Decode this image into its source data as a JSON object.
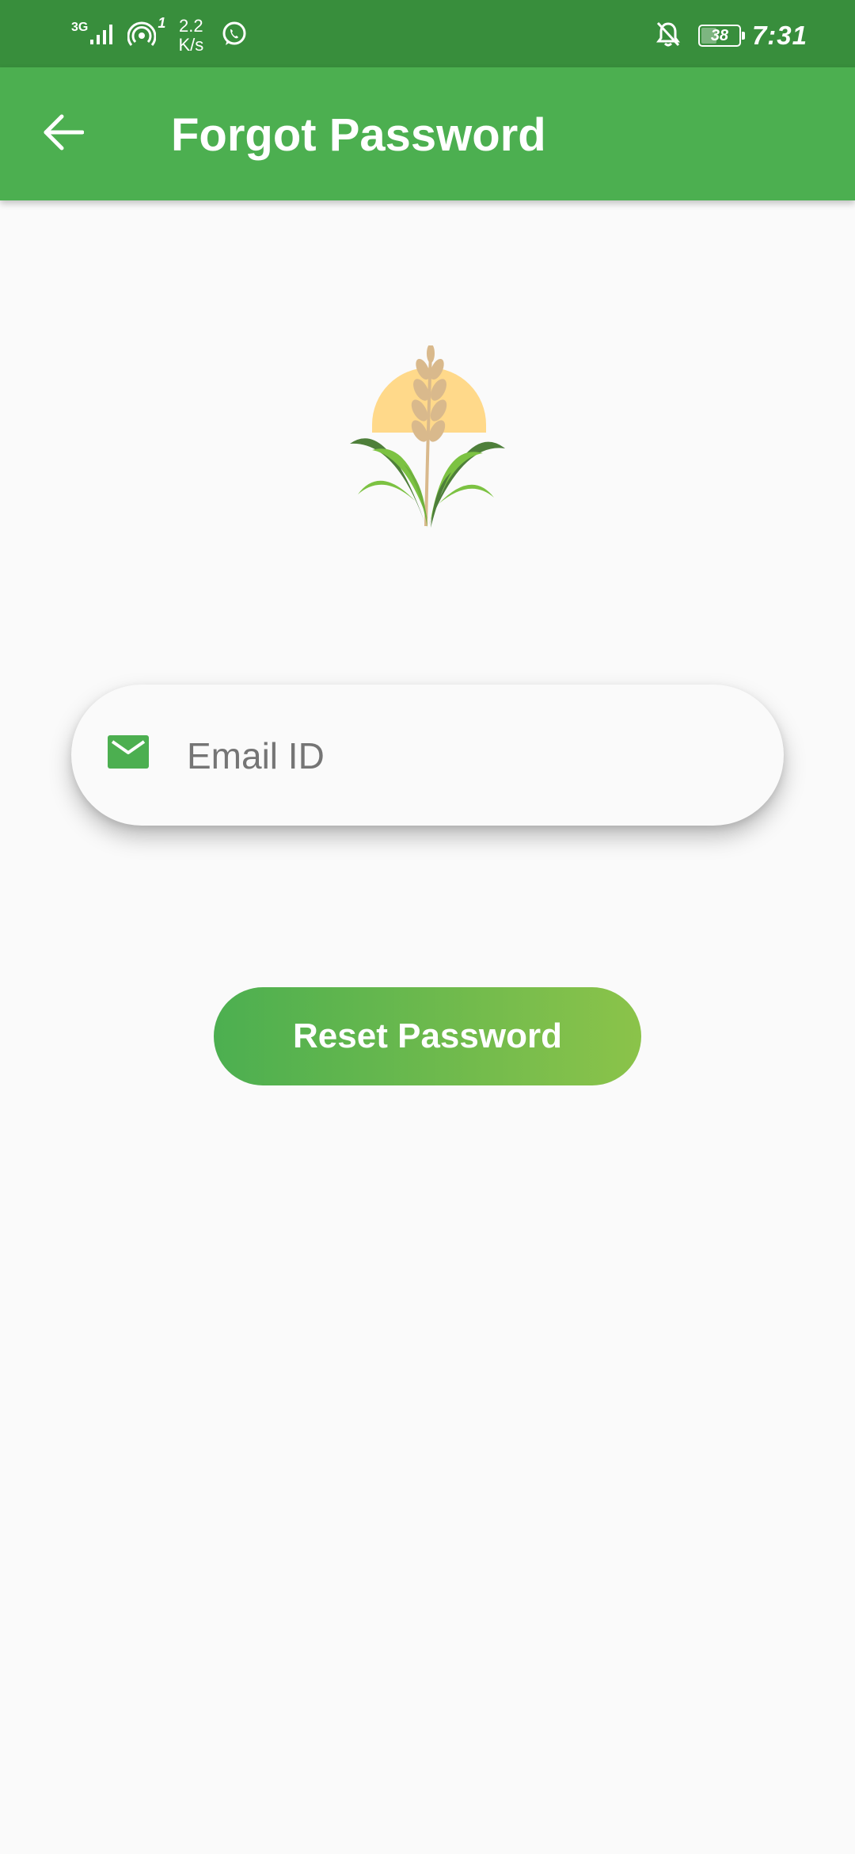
{
  "status_bar": {
    "network_type": "3G",
    "hotspot_count": "1",
    "net_speed_value": "2.2",
    "net_speed_unit": "K/s",
    "battery_level": "38",
    "time": "7:31",
    "icons": [
      "signal-icon",
      "hotspot-icon",
      "whatsapp-icon",
      "notifications-off-icon",
      "battery-icon"
    ]
  },
  "app_bar": {
    "title": "Forgot Password",
    "back_icon": "arrow-back-icon"
  },
  "logo": {
    "icon": "wheat-plant-logo"
  },
  "form": {
    "email_placeholder": "Email ID",
    "email_value": "",
    "email_icon": "mail-icon",
    "submit_label": "Reset Password"
  },
  "colors": {
    "status_bar": "#388E3C",
    "primary": "#4CAF50",
    "accent": "#8BC34A",
    "background": "#FAFAFA",
    "logo_sun": "#FFD98A",
    "logo_wheat": "#D9B98C",
    "logo_leaf_dark": "#4E7F3A",
    "logo_leaf_light": "#7CC242"
  }
}
